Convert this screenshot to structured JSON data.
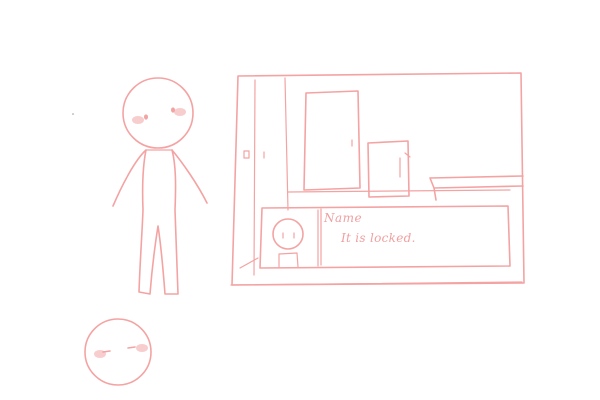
{
  "dialog": {
    "speaker_name": "Name",
    "message": "It is locked."
  },
  "colors": {
    "line": "#f4a3a3",
    "blush": "#f7c4c4",
    "background": "#ffffff"
  },
  "icons": {
    "character": "standing-stick-figure",
    "character_head": "round-head-with-blush",
    "portrait": "character-portrait"
  }
}
